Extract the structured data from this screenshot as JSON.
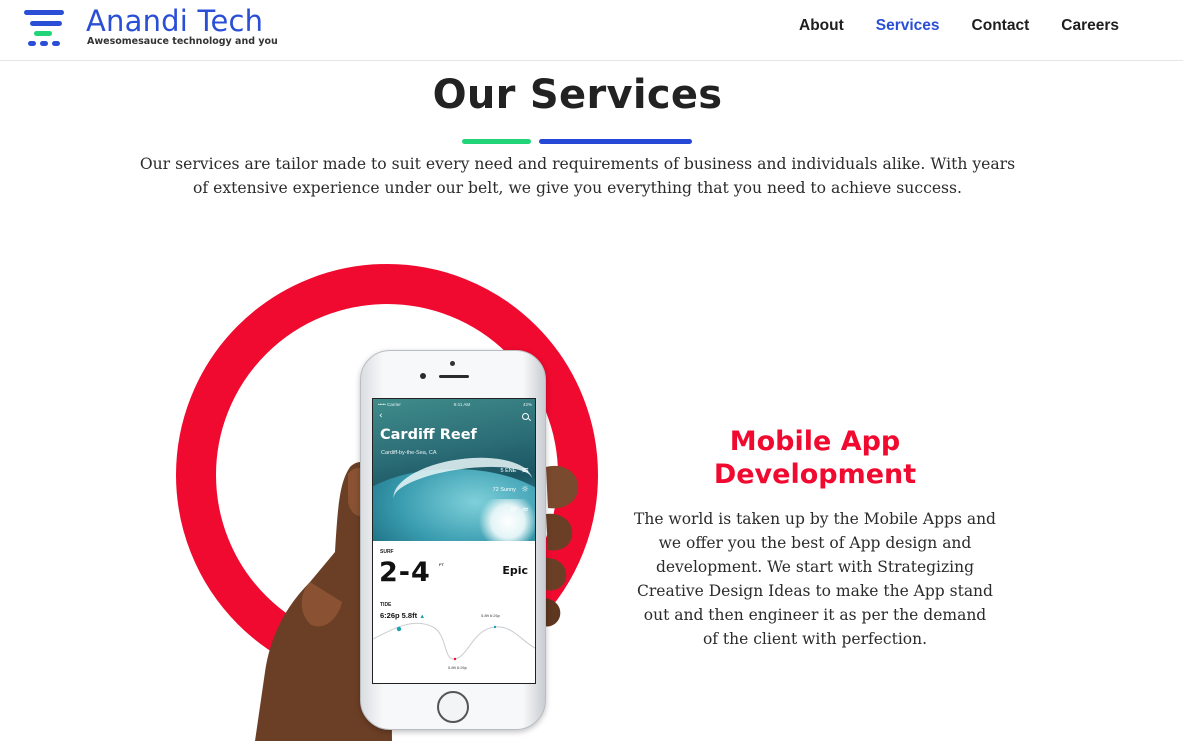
{
  "brand": {
    "name": "Anandi Tech",
    "tagline": "Awesomesauce technology and you",
    "colors": {
      "blue": "#2a4fd6",
      "green": "#21d477",
      "red": "#f00a2f"
    }
  },
  "nav": {
    "items": [
      {
        "label": "About",
        "active": false
      },
      {
        "label": "Services",
        "active": true
      },
      {
        "label": "Contact",
        "active": false
      },
      {
        "label": "Careers",
        "active": false
      }
    ]
  },
  "intro": {
    "title": "Our Services",
    "text": "Our services are tailor made to suit every need and requirements of business and individuals alike. With years of extensive experience under our belt, we give you everything that you need to achieve success."
  },
  "phone_screen": {
    "status_carrier": "••••• Carrier",
    "status_time": "9:41 AM",
    "status_battery": "42%",
    "location": "Cardiff Reef",
    "sublocation": "Cardiff-by-the-Sea, CA",
    "wind": "5 ENE",
    "weather": "72 Sunny",
    "water": "68",
    "surf_label": "SURF",
    "surf_value": "2-4",
    "surf_unit": "FT",
    "surf_rating": "Epic",
    "tide_label": "TIDE",
    "tide_value": "6:26p 5.8ft",
    "tide_high": "5.8ft 6:26p",
    "tide_low": "5.8ft 6:26p"
  },
  "service": {
    "title": "Mobile App Development",
    "description": "The world is taken up by the Mobile Apps and we offer you the best of App design and development. We start with Strategizing Creative Design Ideas to make the App stand out and then engineer it as per the demand of the client with perfection."
  }
}
